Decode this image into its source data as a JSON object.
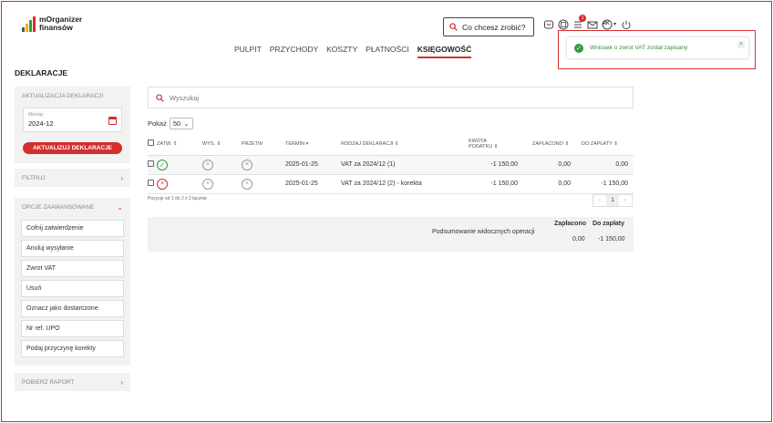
{
  "app": {
    "logo_line1": "mOrganizer",
    "logo_line2": "finansów",
    "search_label": "Co chcesz zrobić?",
    "notification_count": "1",
    "user_initials": "RK"
  },
  "nav": {
    "items": [
      "PULPIT",
      "PRZYCHODY",
      "KOSZTY",
      "PŁATNOŚCI",
      "KSIĘGOWOŚĆ"
    ],
    "active": "KSIĘGOWOŚĆ"
  },
  "toast": {
    "message": "Wniosek o zwrot VAT został zapisany",
    "close": "×"
  },
  "page": {
    "title": "DEKLARACJE"
  },
  "sidebar": {
    "update_panel": {
      "header": "AKTUALIZACJA DEKLARACJI",
      "month_label": "Miesiąc",
      "month_value": "2024-12",
      "button": "AKTUALIZUJ DEKLARACJE"
    },
    "filter_header": "FILTRUJ",
    "advanced_header": "OPCJE ZAAWANSOWANE",
    "advanced_options": [
      "Cofnij zatwierdzenie",
      "Anuluj wysyłanie",
      "Zwrot VAT",
      "Usuń",
      "Oznacz jako dostarczone",
      "Nr ref. UPO",
      "Podaj przyczynę korekty"
    ],
    "report_header": "POBIERZ RAPORT"
  },
  "main": {
    "search_placeholder": "Wyszukaj",
    "show_label": "Pokaż",
    "show_value": "50",
    "columns": {
      "approved": "ZATW.",
      "sent": "WYS.",
      "late": "PRZETW",
      "due": "TERMIN",
      "type": "RODZAJ DEKLARACJI",
      "amount_1": "KWOTA",
      "amount_2": "PODATKU",
      "paid": "ZAPŁACONO",
      "to_pay": "DO ZAPŁATY"
    },
    "rows": [
      {
        "status": "ok",
        "due": "2025-01-25",
        "type": "VAT za 2024/12 (1)",
        "amount": "-1 150,00",
        "paid": "0,00",
        "to_pay": "0,00"
      },
      {
        "status": "rejected",
        "due": "2025-01-25",
        "type": "VAT za 2024/12 (2) - korekta",
        "amount": "-1 150,00",
        "paid": "0,00",
        "to_pay": "-1 150,00"
      }
    ],
    "info": "Pozycje od 1 do 2 z 2 łącznie",
    "pager": {
      "prev": "‹",
      "page": "1",
      "next": "›"
    },
    "summary": {
      "label": "Podsumowanie widocznych operacji",
      "paid_header": "Zapłacono",
      "to_pay_header": "Do zapłaty",
      "paid_value": "0,00",
      "to_pay_value": "-1 150,00"
    }
  },
  "colors": {
    "accent": "#d32f2f",
    "success": "#2e9e3e",
    "panel_bg": "#f2f2f2"
  }
}
